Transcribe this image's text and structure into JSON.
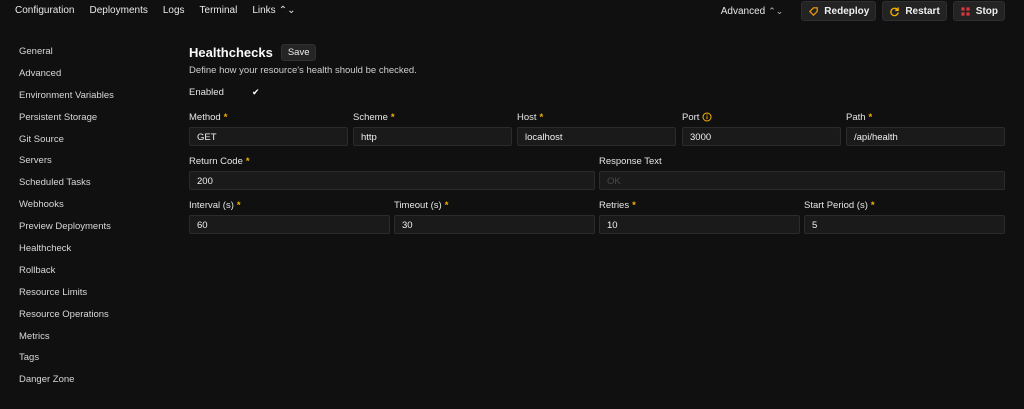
{
  "topnav": [
    {
      "label": "Configuration"
    },
    {
      "label": "Deployments"
    },
    {
      "label": "Logs"
    },
    {
      "label": "Terminal"
    },
    {
      "label": "Links"
    }
  ],
  "topright": {
    "advanced": "Advanced",
    "redeploy": "Redeploy",
    "restart": "Restart",
    "stop": "Stop"
  },
  "sidebar": [
    "General",
    "Advanced",
    "Environment Variables",
    "Persistent Storage",
    "Git Source",
    "Servers",
    "Scheduled Tasks",
    "Webhooks",
    "Preview Deployments",
    "Healthcheck",
    "Rollback",
    "Resource Limits",
    "Resource Operations",
    "Metrics",
    "Tags",
    "Danger Zone"
  ],
  "header": {
    "title": "Healthchecks",
    "save": "Save",
    "description": "Define how your resource's health should be checked."
  },
  "enabled": {
    "label": "Enabled",
    "checked": true
  },
  "fields": {
    "method": {
      "label": "Method",
      "value": "GET"
    },
    "scheme": {
      "label": "Scheme",
      "value": "http"
    },
    "host": {
      "label": "Host",
      "value": "localhost"
    },
    "port": {
      "label": "Port",
      "value": "3000"
    },
    "path": {
      "label": "Path",
      "value": "/api/health"
    },
    "return_code": {
      "label": "Return Code",
      "value": "200"
    },
    "response_text": {
      "label": "Response Text",
      "placeholder": "OK"
    },
    "interval": {
      "label": "Interval (s)",
      "value": "60"
    },
    "timeout": {
      "label": "Timeout (s)",
      "value": "30"
    },
    "retries": {
      "label": "Retries",
      "value": "10"
    },
    "start_period": {
      "label": "Start Period (s)",
      "value": "5"
    }
  },
  "colors": {
    "accent": "#f5b301",
    "background": "#101010",
    "input_bg": "#1a1a1a",
    "stop_icon": "#d9363e",
    "redeploy_icon": "#f59e0b"
  }
}
